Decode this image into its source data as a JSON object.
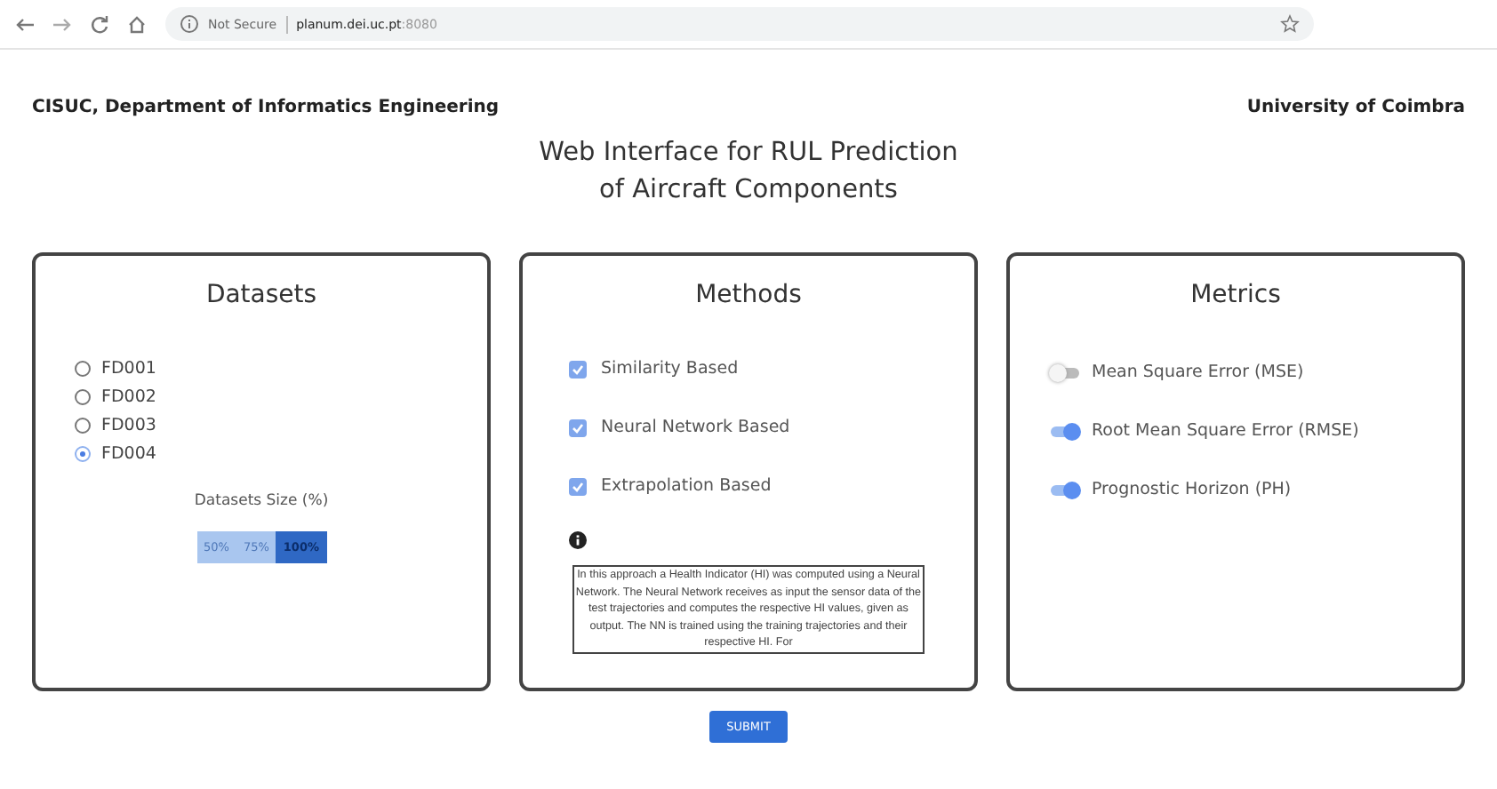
{
  "browser": {
    "security": "Not Secure",
    "url_host": "planum.dei.uc.pt",
    "url_port": ":8080"
  },
  "header": {
    "left": "CISUC, Department of Informatics Engineering",
    "right": "University of Coimbra",
    "title_lines": [
      "Web Interface for RUL Prediction",
      "of Aircraft Components"
    ]
  },
  "datasets": {
    "title": "Datasets",
    "options": [
      {
        "label": "FD001",
        "selected": false
      },
      {
        "label": "FD002",
        "selected": false
      },
      {
        "label": "FD003",
        "selected": false
      },
      {
        "label": "FD004",
        "selected": true
      }
    ],
    "size_label": "Datasets Size (%)",
    "sizes": [
      {
        "label": "50%",
        "selected": false
      },
      {
        "label": "75%",
        "selected": false
      },
      {
        "label": "100%",
        "selected": true
      }
    ]
  },
  "methods": {
    "title": "Methods",
    "options": [
      {
        "label": "Similarity Based",
        "checked": true
      },
      {
        "label": "Neural Network Based",
        "checked": true
      },
      {
        "label": "Extrapolation Based",
        "checked": true
      }
    ],
    "description": "In this approach a Health Indicator (HI) was computed using a Neural Network. The Neural Network receives as input the sensor data of the test trajectories and computes the respective HI values, given as output. The NN is trained using the training trajectories and their respective HI. For"
  },
  "metrics": {
    "title": "Metrics",
    "options": [
      {
        "label": "Mean Square Error (MSE)",
        "on": false
      },
      {
        "label": "Root Mean Square Error (RMSE)",
        "on": true
      },
      {
        "label": "Prognostic Horizon (PH)",
        "on": true
      }
    ]
  },
  "submit": "SUBMIT"
}
